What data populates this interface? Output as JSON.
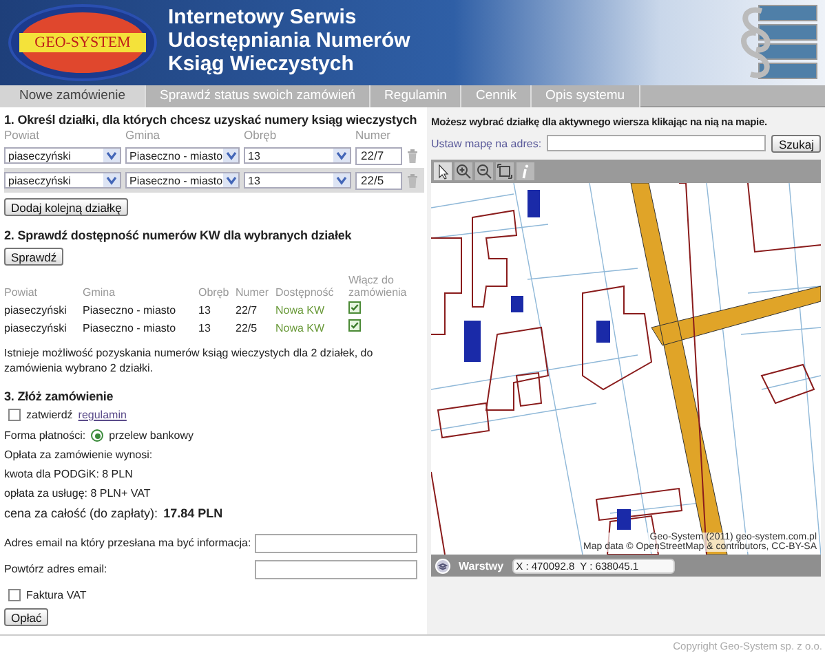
{
  "header": {
    "logo": "GEO-SYSTEM",
    "title_lines": [
      "Internetowy Serwis",
      "Udostępniania Numerów",
      "Ksiąg Wieczystych"
    ]
  },
  "nav": [
    {
      "label": "Nowe zamówienie",
      "selected": true
    },
    {
      "label": "Sprawdź status swoich zamówień",
      "selected": false
    },
    {
      "label": "Regulamin",
      "selected": false
    },
    {
      "label": "Cennik",
      "selected": false
    },
    {
      "label": "Opis systemu",
      "selected": false
    }
  ],
  "step1": {
    "title": "1. Określ działki, dla których chcesz uzyskać numery ksiąg wieczystych",
    "columns": [
      "Powiat",
      "Gmina",
      "Obręb",
      "Numer"
    ],
    "rows": [
      {
        "powiat": "piaseczyński",
        "gmina": "Piaseczno - miasto",
        "obreb": "13",
        "numer": "22/7",
        "selected": false
      },
      {
        "powiat": "piaseczyński",
        "gmina": "Piaseczno - miasto",
        "obreb": "13",
        "numer": "22/5",
        "selected": true
      }
    ],
    "add_button": "Dodaj kolejną działkę"
  },
  "step2": {
    "title": "2. Sprawdź dostępność numerów KW dla wybranych działek",
    "check_button": "Sprawdź",
    "columns": [
      "Powiat",
      "Gmina",
      "Obręb",
      "Numer",
      "Dostępność",
      "Włącz do zamówienia"
    ],
    "rows": [
      {
        "powiat": "piaseczyński",
        "gmina": "Piaseczno - miasto",
        "obreb": "13",
        "numer": "22/7",
        "availability": "Nowa KW",
        "included": true
      },
      {
        "powiat": "piaseczyński",
        "gmina": "Piaseczno - miasto",
        "obreb": "13",
        "numer": "22/5",
        "availability": "Nowa KW",
        "included": true
      }
    ],
    "message": "Istnieje możliwość pozyskania numerów ksiąg wieczystych dla 2 działek, do zamówienia wybrano 2 działki."
  },
  "step3": {
    "title": "3. Złóż zamówienie",
    "accept": {
      "text": "zatwierdź",
      "link": "regulamin",
      "checked": false
    },
    "payment": {
      "label": "Forma płatności:",
      "options": [
        {
          "label": "przelew bankowy",
          "selected": true
        }
      ]
    },
    "fee_lines": [
      "Opłata za zamówienie wynosi:",
      "kwota dla PODGiK: 8 PLN",
      "opłata za usługę: 8 PLN+ VAT"
    ],
    "total": "cena za całość (do zapłaty): **17.84 PLN**",
    "fields": [
      {
        "label": "Adres email na który przesłana ma być informacja:"
      },
      {
        "label": "Powtórz adres email:"
      }
    ],
    "invoice": {
      "label": "Faktura VAT",
      "checked": false
    },
    "pay_button": "Opłać"
  },
  "map_panel": {
    "hint": "Możesz wybrać działkę dla aktywnego wiersza klikając na nią na mapie.",
    "address_label": "Ustaw mapę na adres:",
    "search_button": "Szukaj",
    "tools": [
      {
        "kind": "pointer",
        "selected": true
      },
      {
        "kind": "zoom_in",
        "selected": false
      },
      {
        "kind": "zoom_out",
        "selected": false
      },
      {
        "kind": "extent",
        "selected": false
      },
      {
        "kind": "info",
        "selected": false
      }
    ],
    "attribution": [
      "Geo-System (2011) geo-system.com.pl",
      "Map data © OpenStreetMap & contributors, CC-BY-SA"
    ],
    "layers_label": "Warstwy",
    "coordinates": "X : 470092.8  Y : 638045.1"
  },
  "footer": "Copyright Geo-System sp. z o.o."
}
